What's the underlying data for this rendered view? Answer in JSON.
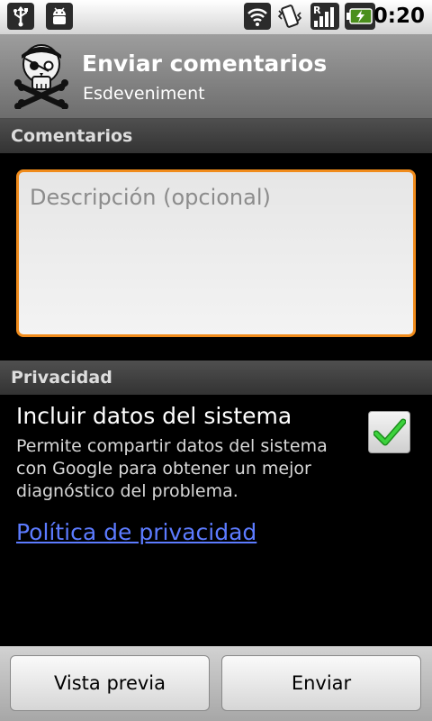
{
  "status_bar": {
    "icons": [
      "usb-icon",
      "android-debug-icon",
      "wifi-icon",
      "vibrate-icon",
      "signal-roaming-icon",
      "battery-charging-icon"
    ],
    "roaming_indicator": "R",
    "time": "0:20"
  },
  "header": {
    "title": "Enviar comentarios",
    "subtitle": "Esdeveniment",
    "icon": "pirate-skull-icon"
  },
  "comments_section": {
    "header": "Comentarios",
    "description_placeholder": "Descripción (opcional)",
    "description_value": ""
  },
  "privacy_section": {
    "header": "Privacidad",
    "include_label": "Incluir datos del sistema",
    "include_description": "Permite compartir datos del sistema con Google para obtener un mejor diagnóstico del problema.",
    "include_checked": true,
    "privacy_link": "Política de privacidad"
  },
  "buttons": {
    "preview": "Vista previa",
    "send": "Enviar"
  },
  "colors": {
    "focus_border": "#f08b1b",
    "link": "#5c7bff",
    "check": "#2fb52f"
  }
}
